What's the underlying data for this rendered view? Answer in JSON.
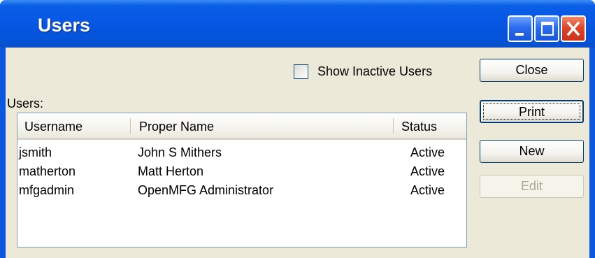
{
  "window": {
    "title": "Users"
  },
  "filter": {
    "show_inactive_label": "Show Inactive Users",
    "show_inactive_checked": false
  },
  "users_label": "Users:",
  "table": {
    "columns": [
      "Username",
      "Proper Name",
      "Status"
    ],
    "rows": [
      [
        "jsmith",
        "John S Mithers",
        "Active"
      ],
      [
        "matherton",
        "Matt Herton",
        "Active"
      ],
      [
        "mfgadmin",
        "OpenMFG Administrator",
        "Active"
      ]
    ]
  },
  "buttons": {
    "close": "Close",
    "print": "Print",
    "new": "New",
    "edit": "Edit"
  },
  "colors": {
    "titlebar": "#0656e3",
    "client_background": "#ece9d8",
    "close_button": "#e0462a"
  }
}
